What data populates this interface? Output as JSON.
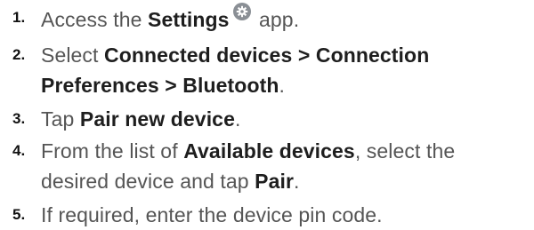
{
  "steps": [
    {
      "number": "1.",
      "parts": {
        "a": "Access the ",
        "b": "Settings",
        "c": " app."
      },
      "icon": "settings-gear-icon"
    },
    {
      "number": "2.",
      "parts": {
        "a": "Select ",
        "b": "Connected devices > Connection",
        "c": "Preferences > Bluetooth",
        "d": "."
      }
    },
    {
      "number": "3.",
      "parts": {
        "a": "Tap ",
        "b": "Pair new device",
        "c": "."
      }
    },
    {
      "number": "4.",
      "parts": {
        "a": "From the list of ",
        "b": "Available devices",
        "c": ", select the",
        "d": "desired device and tap ",
        "e": "Pair",
        "f": "."
      }
    },
    {
      "number": "5.",
      "parts": {
        "a": "If required, enter the device pin code."
      }
    }
  ]
}
